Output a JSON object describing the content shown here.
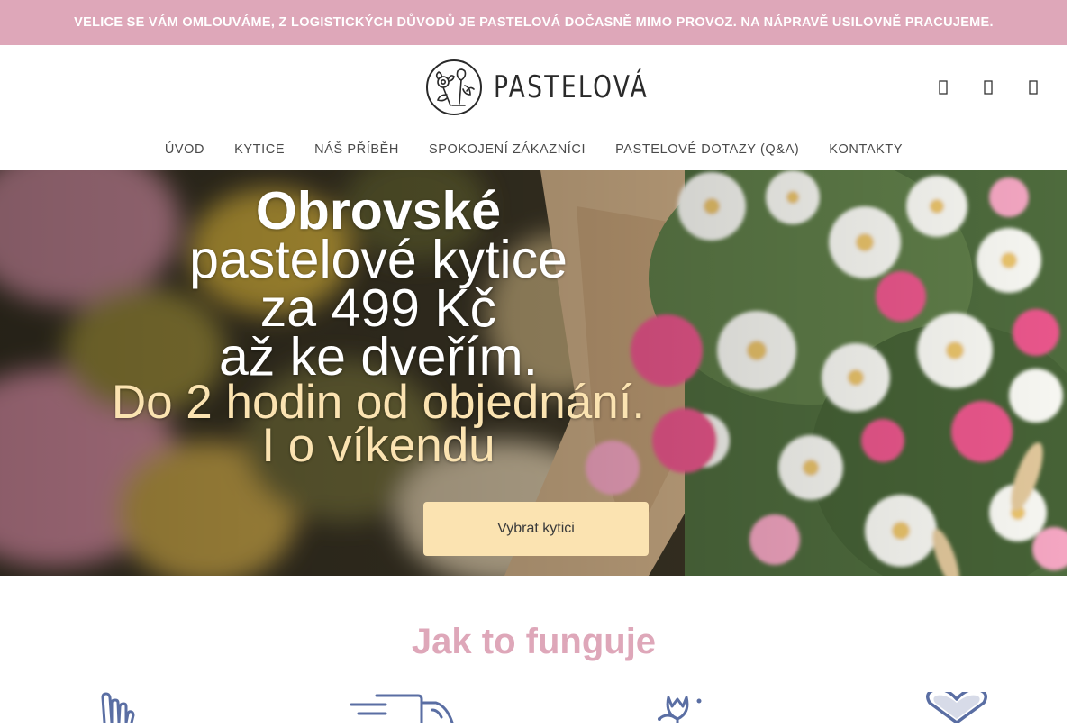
{
  "notice": {
    "text": "VELICE SE VÁM OMLOUVÁME, Z LOGISTICKÝCH DŮVODŮ JE PASTELOVÁ DOČASNĚ MIMO PROVOZ. NA NÁPRAVĚ USILOVNĚ PRACUJEME."
  },
  "header": {
    "logo_text": "PASTELOVÁ",
    "icons": [
      "search-icon",
      "user-icon",
      "cart-icon"
    ],
    "nav": [
      {
        "label": "ÚVOD"
      },
      {
        "label": "KYTICE"
      },
      {
        "label": "NÁŠ PŘÍBĚH"
      },
      {
        "label": "SPOKOJENÍ ZÁKAZNÍCI"
      },
      {
        "label": "PASTELOVÉ DOTAZY (Q&A)"
      },
      {
        "label": "KONTAKTY"
      }
    ]
  },
  "hero": {
    "line1": "Obrovské",
    "line2": "pastelové kytice",
    "line3": "za 499 Kč",
    "line4": "až ke dveřím.",
    "line5": "Do 2 hodin od objednání.",
    "line6": "I o víkendu",
    "cta_label": "Vybrat kytici"
  },
  "how": {
    "title": "Jak to funguje",
    "icons": [
      "hand-pointer-icon",
      "delivery-truck-icon",
      "flower-tulip-icon",
      "heart-icon"
    ]
  },
  "colors": {
    "brand_pink": "#dea7b9",
    "accent_cream": "#fbe3b1",
    "icon_blue": "#5a6ea3"
  }
}
